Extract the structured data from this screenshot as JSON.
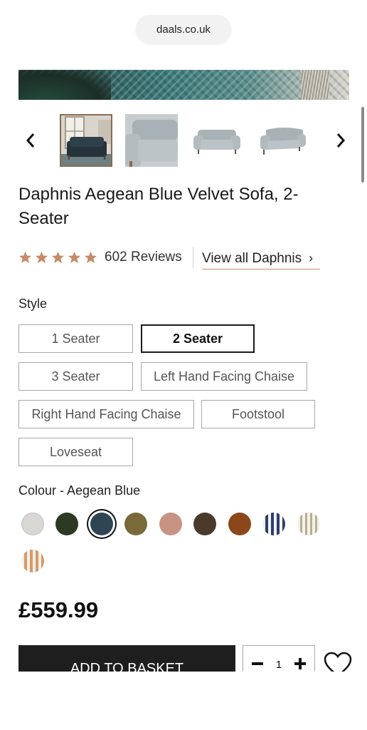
{
  "browser": {
    "url": "daals.co.uk"
  },
  "gallery": {
    "thumbnails": [
      {
        "name": "sofa-in-room"
      },
      {
        "name": "sofa-closeup"
      },
      {
        "name": "sofa-front"
      },
      {
        "name": "sofa-angle"
      }
    ],
    "selected_index": 0
  },
  "product": {
    "title": "Daphnis Aegean Blue Velvet Sofa, 2-Seater",
    "rating": 5,
    "reviews_label": "602 Reviews",
    "view_all_label": "View all Daphnis",
    "price": "£559.99"
  },
  "style": {
    "label": "Style",
    "options": [
      "1 Seater",
      "2 Seater",
      "3 Seater",
      "Left Hand Facing Chaise",
      "Right Hand Facing Chaise",
      "Footstool",
      "Loveseat"
    ],
    "selected": "2 Seater"
  },
  "colour": {
    "label": "Colour - Aegean Blue",
    "selected_index": 2,
    "swatches": [
      {
        "name": "light-grey",
        "color": "#d9d7d3"
      },
      {
        "name": "dark-green",
        "color": "#2c3a23"
      },
      {
        "name": "aegean-blue",
        "color": "#2f4553"
      },
      {
        "name": "olive",
        "color": "#7a6a3a"
      },
      {
        "name": "blush",
        "color": "#c79483"
      },
      {
        "name": "dark-brown",
        "color": "#4a3a2c"
      },
      {
        "name": "rust",
        "color": "#8b4619"
      },
      {
        "name": "navy-stripe",
        "color": "#2b3f6e"
      },
      {
        "name": "sage-stripe",
        "color": "#b8b08c"
      },
      {
        "name": "terracotta-stripe",
        "color": "#d49a6a"
      }
    ]
  },
  "actions": {
    "add_to_basket": "ADD TO BASKET",
    "quantity": "1"
  },
  "colors": {
    "accent": "#c68b6a",
    "star": "#c68b6a",
    "button": "#1e1e1e"
  }
}
